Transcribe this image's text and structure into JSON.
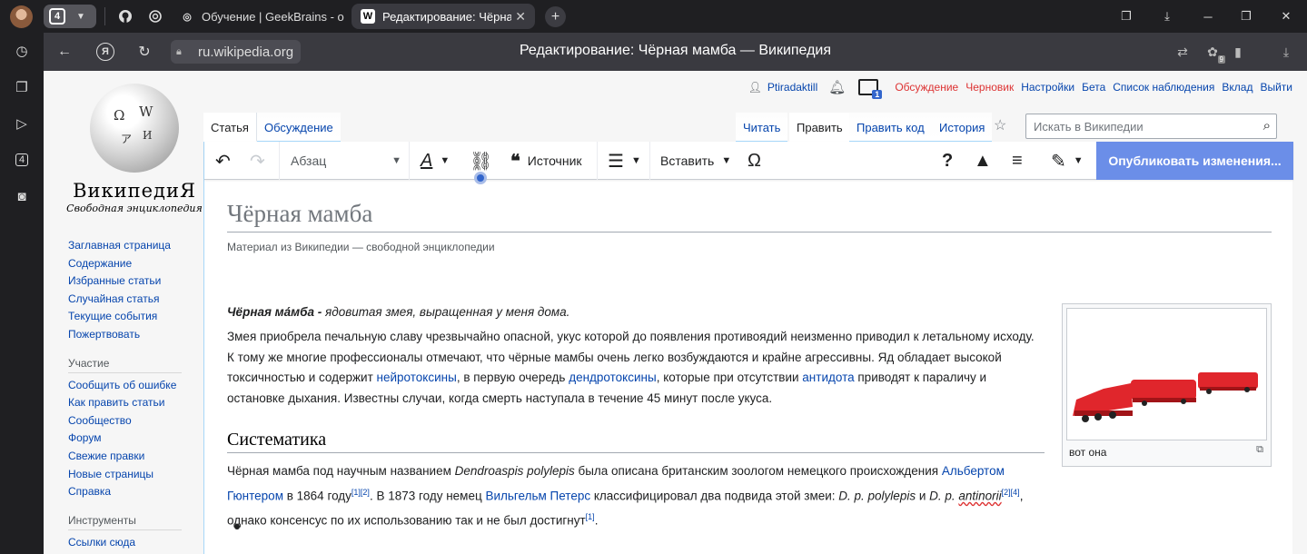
{
  "browser": {
    "tab_count": "4",
    "tabs": [
      {
        "title": "Обучение | GeekBrains - о"
      },
      {
        "title": "Редактирование: Чёрна"
      }
    ],
    "address": "ru.wikipedia.org",
    "page_title": "Редактирование: Чёрная мамба — Википедия",
    "sidebar_badge": "4",
    "ext_badge": "9"
  },
  "wiki": {
    "wordmark": "ВикипедиЯ",
    "tagline": "Свободная энциклопедия",
    "nav_main": [
      "Заглавная страница",
      "Содержание",
      "Избранные статьи",
      "Случайная статья",
      "Текущие события",
      "Пожертвовать"
    ],
    "nav_participation_head": "Участие",
    "nav_participation": [
      "Сообщить об ошибке",
      "Как править статьи",
      "Сообщество",
      "Форум",
      "Свежие правки",
      "Новые страницы",
      "Справка"
    ],
    "nav_tools_head": "Инструменты",
    "nav_tools": [
      "Ссылки сюда"
    ],
    "personal": {
      "user": "Ptiradaktill",
      "notice_badge": "1",
      "talk": "Обсуждение",
      "draft": "Черновик",
      "settings": "Настройки",
      "beta": "Бета",
      "watchlist": "Список наблюдения",
      "contribs": "Вклад",
      "logout": "Выйти"
    },
    "tabs": {
      "article": "Статья",
      "talk": "Обсуждение",
      "read": "Читать",
      "edit": "Править",
      "edit_source": "Править код",
      "history": "История"
    },
    "search_placeholder": "Искать в Википедии",
    "toolbar": {
      "paragraph": "Абзац",
      "cite": "Источник",
      "insert": "Вставить",
      "publish": "Опубликовать изменения..."
    },
    "article": {
      "title": "Чёрная мамба",
      "subtitle": "Материал из Википедии — свободной энциклопедии",
      "lead_bold": "Чёрная ма́мба -",
      "lead_italic": " ядовитая змея, выращенная у меня дома.",
      "p1_a": "Змея приобрела печальную славу чрезвычайно опасной, укус которой до появления противоядий неизменно приводил к летальному исходу. К тому же многие профессионалы отмечают, что чёрные мамбы очень легко возбуждаются и крайне агрессивны. Яд обладает высокой токсичностью и содержит ",
      "p1_link1": "нейротоксины",
      "p1_b": ", в первую очередь ",
      "p1_link2": "дендротоксины",
      "p1_c": ", которые при отсутствии ",
      "p1_link3": "антидота",
      "p1_d": " приводят к параличу и остановке дыхания. Известны случаи, когда смерть наступала в течение 45 минут после укуса.",
      "h2": "Систематика",
      "p2_a": "Чёрная мамба под научным названием ",
      "p2_i1": "Dendroaspis polylepis",
      "p2_b": " была описана британским зоологом немецкого происхождения ",
      "p2_link1": "Альбертом Гюнтером",
      "p2_c": " в 1864 году",
      "p2_ref1": "[1][2]",
      "p2_d": ". В 1873 году немец ",
      "p2_link2": "Вильгельм Петерс",
      "p2_e": " классифицировал два подвида этой змеи: ",
      "p2_i2": "D. p. polylepis",
      "p2_f": " и ",
      "p2_i3a": "D. p. ",
      "p2_i3b": "antinorii",
      "p2_ref2": "[2][4]",
      "p2_g": ", однако консенсус по их использованию так и не был достигнут",
      "p2_ref3": "[1]",
      "p2_h": ".",
      "thumb_caption": "вот она"
    }
  },
  "colors": {
    "link": "#0645ad",
    "red": "#d33",
    "publish": "#6b8ee8",
    "train": "#e0262c"
  }
}
